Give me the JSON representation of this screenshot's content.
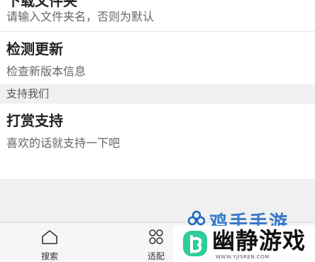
{
  "settings": {
    "items": [
      {
        "title": "下载文件夹",
        "subtitle": "请输入文件夹名，否则为默认"
      },
      {
        "title": "检测更新",
        "subtitle": "检查新版本信息"
      }
    ],
    "section_support": "支持我们",
    "support_items": [
      {
        "title": "打赏支持",
        "subtitle": "喜欢的话就支持一下吧"
      }
    ]
  },
  "bottom_nav": {
    "tabs": [
      {
        "label": "搜索",
        "icon": "home-icon"
      },
      {
        "label": "适配",
        "icon": "grid-icon"
      }
    ]
  },
  "watermark": {
    "top_text": "鸡手手游",
    "title": "幽静游戏",
    "url": "WWW.YJISREN.COM"
  },
  "colors": {
    "accent_green": "#2ecc9a",
    "brand_blue": "#1565c0"
  }
}
